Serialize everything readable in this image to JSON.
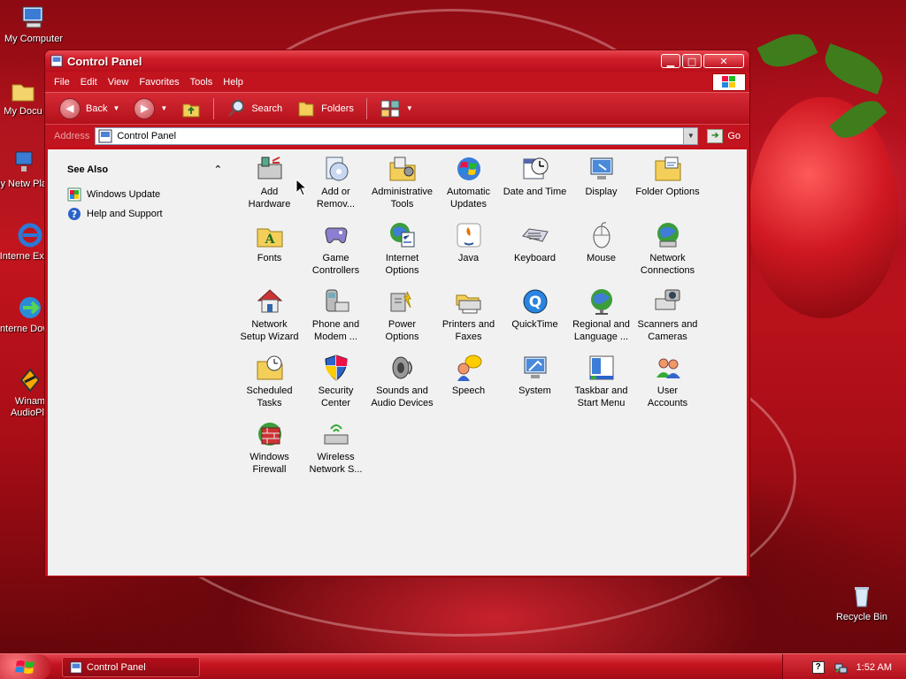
{
  "desktop": {
    "icons": [
      {
        "label": "My Computer"
      },
      {
        "label": "My Docu"
      },
      {
        "label": "My Netw Place"
      },
      {
        "label": "Interne Explor"
      },
      {
        "label": "Interne Downlo"
      },
      {
        "label": "Winam AudioPla"
      },
      {
        "label": "Recycle Bin"
      }
    ]
  },
  "window": {
    "title": "Control Panel",
    "menus": [
      "File",
      "Edit",
      "View",
      "Favorites",
      "Tools",
      "Help"
    ],
    "toolbar": {
      "back_label": "Back",
      "search_label": "Search",
      "folders_label": "Folders"
    },
    "address": {
      "label": "Address",
      "value": "Control Panel",
      "go_label": "Go"
    },
    "taskpane": {
      "title": "See Also",
      "links": [
        "Windows Update",
        "Help and Support"
      ]
    },
    "items": [
      {
        "line1": "Add",
        "line2": "Hardware",
        "icon": "add-hardware-icon"
      },
      {
        "line1": "Add or",
        "line2": "Remov...",
        "icon": "add-remove-programs-icon"
      },
      {
        "line1": "Administrative",
        "line2": "Tools",
        "icon": "administrative-tools-icon"
      },
      {
        "line1": "Automatic",
        "line2": "Updates",
        "icon": "automatic-updates-icon"
      },
      {
        "line1": "Date and Time",
        "line2": "",
        "icon": "date-time-icon"
      },
      {
        "line1": "Display",
        "line2": "",
        "icon": "display-icon"
      },
      {
        "line1": "Folder Options",
        "line2": "",
        "icon": "folder-options-icon"
      },
      {
        "line1": "Fonts",
        "line2": "",
        "icon": "fonts-icon"
      },
      {
        "line1": "Game",
        "line2": "Controllers",
        "icon": "game-controllers-icon"
      },
      {
        "line1": "Internet",
        "line2": "Options",
        "icon": "internet-options-icon"
      },
      {
        "line1": "Java",
        "line2": "",
        "icon": "java-icon"
      },
      {
        "line1": "Keyboard",
        "line2": "",
        "icon": "keyboard-icon"
      },
      {
        "line1": "Mouse",
        "line2": "",
        "icon": "mouse-icon"
      },
      {
        "line1": "Network",
        "line2": "Connections",
        "icon": "network-connections-icon"
      },
      {
        "line1": "Network",
        "line2": "Setup Wizard",
        "icon": "network-setup-wizard-icon"
      },
      {
        "line1": "Phone and",
        "line2": "Modem ...",
        "icon": "phone-modem-icon"
      },
      {
        "line1": "Power",
        "line2": "Options",
        "icon": "power-options-icon"
      },
      {
        "line1": "Printers and",
        "line2": "Faxes",
        "icon": "printers-faxes-icon"
      },
      {
        "line1": "QuickTime",
        "line2": "",
        "icon": "quicktime-icon"
      },
      {
        "line1": "Regional and",
        "line2": "Language ...",
        "icon": "regional-language-icon"
      },
      {
        "line1": "Scanners and",
        "line2": "Cameras",
        "icon": "scanners-cameras-icon"
      },
      {
        "line1": "Scheduled",
        "line2": "Tasks",
        "icon": "scheduled-tasks-icon"
      },
      {
        "line1": "Security",
        "line2": "Center",
        "icon": "security-center-icon"
      },
      {
        "line1": "Sounds and",
        "line2": "Audio Devices",
        "icon": "sounds-audio-icon"
      },
      {
        "line1": "Speech",
        "line2": "",
        "icon": "speech-icon"
      },
      {
        "line1": "System",
        "line2": "",
        "icon": "system-icon"
      },
      {
        "line1": "Taskbar and",
        "line2": "Start Menu",
        "icon": "taskbar-start-menu-icon"
      },
      {
        "line1": "User",
        "line2": "Accounts",
        "icon": "user-accounts-icon"
      },
      {
        "line1": "Windows",
        "line2": "Firewall",
        "icon": "windows-firewall-icon"
      },
      {
        "line1": "Wireless",
        "line2": "Network S...",
        "icon": "wireless-network-icon"
      }
    ]
  },
  "taskbar": {
    "task_label": "Control Panel",
    "clock": "1:52 AM",
    "help_glyph": "?"
  }
}
